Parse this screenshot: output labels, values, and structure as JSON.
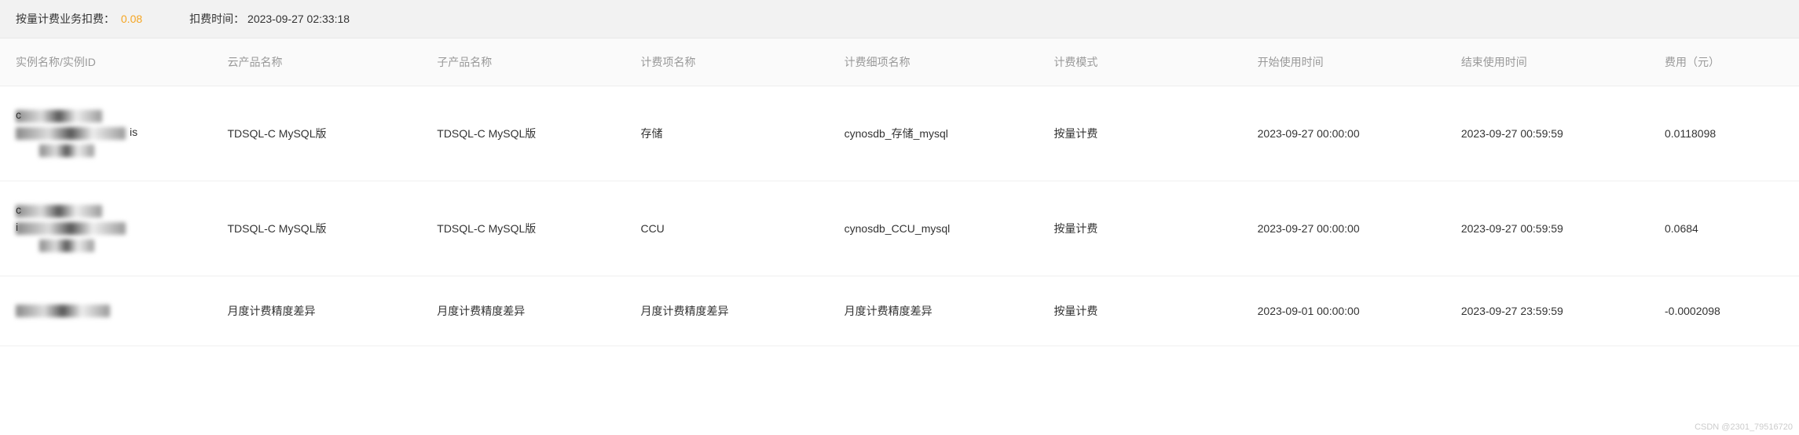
{
  "header": {
    "fee_label": "按量计费业务扣费：",
    "fee_value": "0.08",
    "time_label": "扣费时间：",
    "time_value": "2023-09-27 02:33:18"
  },
  "table": {
    "columns": {
      "instance": "实例名称/实例ID",
      "product": "云产品名称",
      "subproduct": "子产品名称",
      "billing_item": "计费项名称",
      "billing_detail": "计费细项名称",
      "billing_mode": "计费模式",
      "start_time": "开始使用时间",
      "end_time": "结束使用时间",
      "cost": "费用（元）"
    },
    "rows": [
      {
        "instance_prefix_0": "c",
        "instance_suffix_1": "is",
        "product": "TDSQL-C MySQL版",
        "subproduct": "TDSQL-C MySQL版",
        "billing_item": "存储",
        "billing_detail": "cynosdb_存储_mysql",
        "billing_mode": "按量计费",
        "start_time": "2023-09-27 00:00:00",
        "end_time": "2023-09-27 00:59:59",
        "cost": "0.0118098"
      },
      {
        "instance_prefix_0": "c",
        "instance_prefix_1": "i",
        "product": "TDSQL-C MySQL版",
        "subproduct": "TDSQL-C MySQL版",
        "billing_item": "CCU",
        "billing_detail": "cynosdb_CCU_mysql",
        "billing_mode": "按量计费",
        "start_time": "2023-09-27 00:00:00",
        "end_time": "2023-09-27 00:59:59",
        "cost": "0.0684"
      },
      {
        "product": "月度计费精度差异",
        "subproduct": "月度计费精度差异",
        "billing_item": "月度计费精度差异",
        "billing_detail": "月度计费精度差异",
        "billing_mode": "按量计费",
        "start_time": "2023-09-01 00:00:00",
        "end_time": "2023-09-27 23:59:59",
        "cost": "-0.0002098"
      }
    ]
  },
  "watermark": "CSDN @2301_79516720"
}
